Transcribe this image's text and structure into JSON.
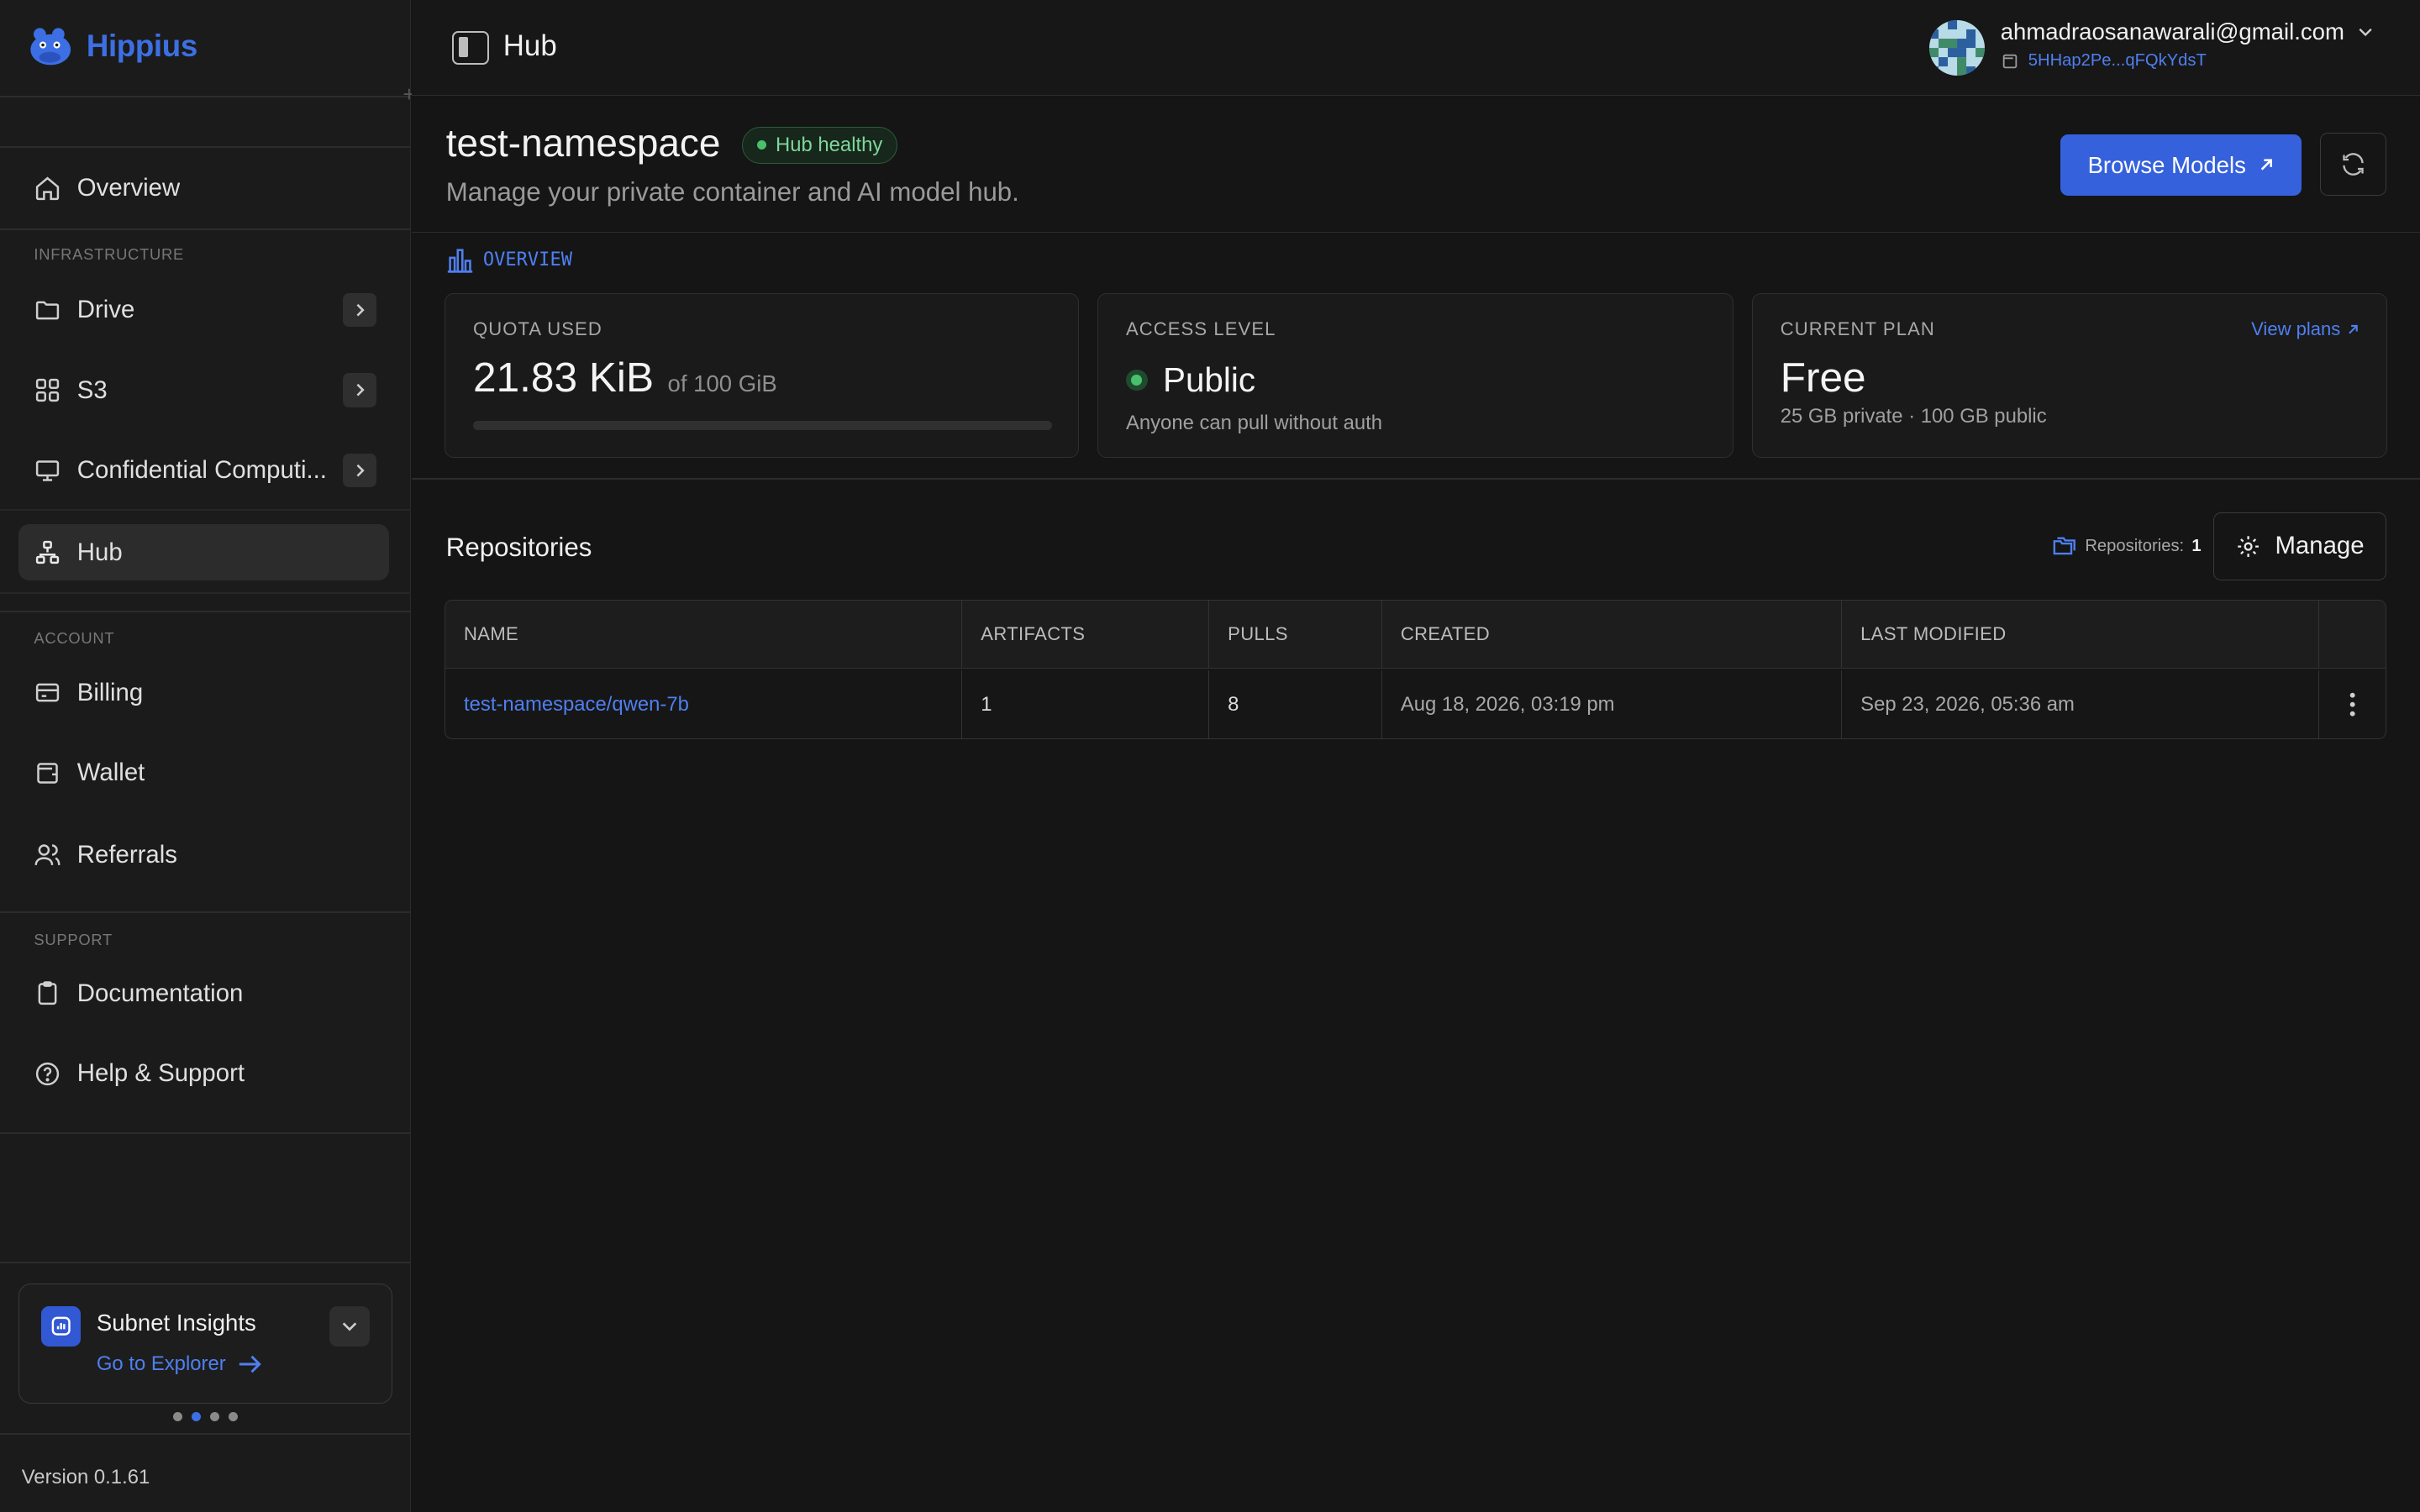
{
  "brand": {
    "name": "Hippius",
    "accent": "#3D6FE4"
  },
  "sidebar": {
    "overview": {
      "label": "Overview",
      "icon": "home-icon"
    },
    "sections": {
      "infrastructure": "INFRASTRUCTURE",
      "account": "ACCOUNT",
      "support": "SUPPORT"
    },
    "items": [
      {
        "label": "Drive",
        "icon": "folder-icon",
        "expandable": true
      },
      {
        "label": "S3",
        "icon": "grid-icon",
        "expandable": true
      },
      {
        "label": "Confidential Computi...",
        "icon": "monitor-icon",
        "expandable": true
      },
      {
        "label": "Hub",
        "icon": "network-icon",
        "active": true
      },
      {
        "label": "Billing",
        "icon": "card-icon"
      },
      {
        "label": "Wallet",
        "icon": "wallet-icon"
      },
      {
        "label": "Referrals",
        "icon": "users-icon"
      },
      {
        "label": "Documentation",
        "icon": "clipboard-icon"
      },
      {
        "label": "Help & Support",
        "icon": "help-icon"
      }
    ],
    "insights": {
      "title": "Subnet Insights",
      "link": "Go to Explorer",
      "active_dot": 1
    },
    "version": "Version 0.1.61"
  },
  "topbar": {
    "title": "Hub",
    "user_email": "ahmadraosanawarali@gmail.com",
    "wallet_address": "5HHap2Pe...qFQkYdsT"
  },
  "header": {
    "namespace": "test-namespace",
    "health": "Hub healthy",
    "subtitle": "Manage your private container and AI model hub.",
    "browse_label": "Browse Models"
  },
  "overview": {
    "section_label": "OVERVIEW",
    "quota": {
      "label": "QUOTA USED",
      "value": "21.83 KiB",
      "of": "of 100 GiB",
      "fraction": 2e-07
    },
    "access": {
      "label": "ACCESS LEVEL",
      "value": "Public",
      "sub": "Anyone can pull without auth",
      "status_color": "#49C06C"
    },
    "plan": {
      "label": "CURRENT PLAN",
      "value": "Free",
      "sub": "25 GB private · 100 GB public",
      "link": "View plans"
    }
  },
  "repositories": {
    "title": "Repositories",
    "count_label": "Repositories:",
    "count": "1",
    "manage_label": "Manage",
    "columns": [
      "NAME",
      "ARTIFACTS",
      "PULLS",
      "CREATED",
      "LAST MODIFIED"
    ],
    "rows": [
      {
        "name": "test-namespace/qwen-7b",
        "artifacts": "1",
        "pulls": "8",
        "created": "Aug 18, 2026, 03:19 pm",
        "modified": "Sep 23, 2026, 05:36 am"
      }
    ]
  }
}
